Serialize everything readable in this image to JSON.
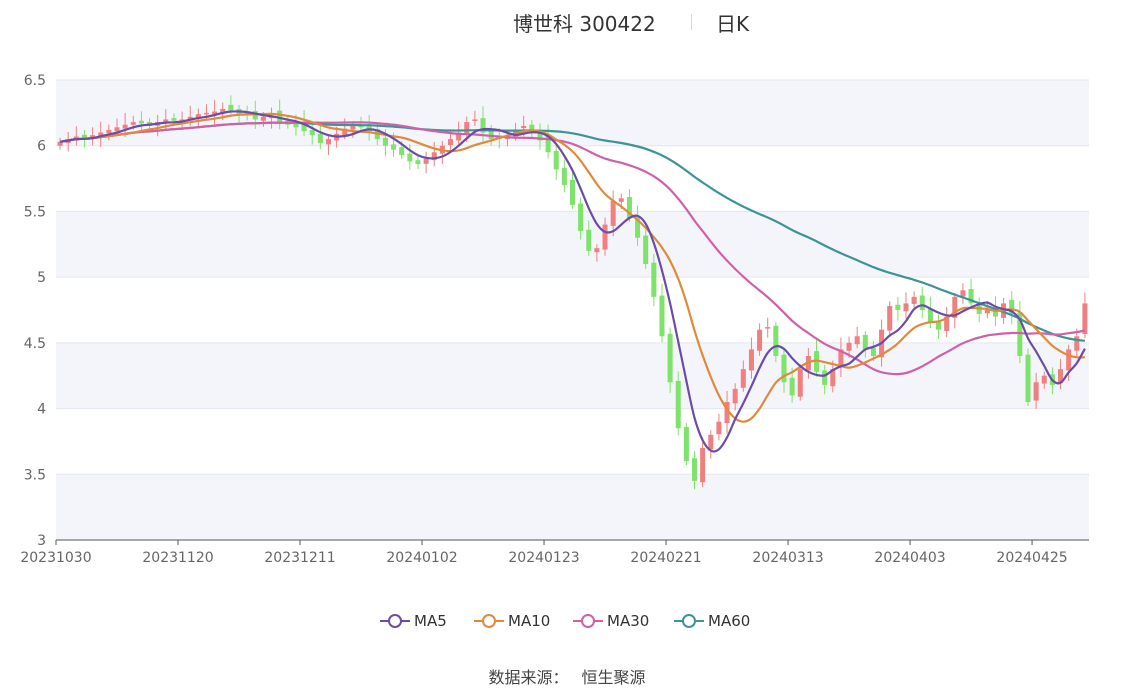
{
  "title": {
    "main": "博世科 300422",
    "sub": "日K"
  },
  "source": {
    "label": "数据来源：",
    "value": "恒生聚源"
  },
  "colors": {
    "up": "#f08080",
    "down": "#7ee36a",
    "ma5": "#6b4ca8",
    "ma10": "#e08a3c",
    "ma30": "#d160a8",
    "ma60": "#3c9498",
    "axis": "#555555",
    "grid": "#e3e6ee",
    "band": "#f4f5fa"
  },
  "chart_data": {
    "type": "candlestick",
    "ylim": [
      3,
      6.5
    ],
    "yticks": [
      "3",
      "3.5",
      "4",
      "4.5",
      "5",
      "5.5",
      "6",
      "6.5"
    ],
    "xticks": [
      "20231030",
      "20231120",
      "20231211",
      "20240102",
      "20240123",
      "20240221",
      "20240313",
      "20240403",
      "20240425"
    ],
    "xtick_index": [
      0,
      15,
      30,
      45,
      60,
      75,
      90,
      105,
      120
    ],
    "legend": [
      "MA5",
      "MA10",
      "MA30",
      "MA60"
    ],
    "close": [
      6.03,
      6.05,
      6.07,
      6.06,
      6.08,
      6.1,
      6.12,
      6.14,
      6.16,
      6.18,
      6.17,
      6.15,
      6.18,
      6.2,
      6.19,
      6.2,
      6.22,
      6.24,
      6.25,
      6.26,
      6.28,
      6.27,
      6.24,
      6.23,
      6.2,
      6.22,
      6.23,
      6.18,
      6.16,
      6.14,
      6.11,
      6.08,
      6.02,
      6.05,
      6.09,
      6.13,
      6.15,
      6.14,
      6.11,
      6.05,
      6.0,
      5.97,
      5.93,
      5.88,
      5.86,
      5.9,
      5.95,
      6.0,
      6.05,
      6.1,
      6.18,
      6.2,
      6.1,
      6.05,
      6.06,
      6.08,
      6.12,
      6.15,
      6.1,
      6.04,
      5.95,
      5.82,
      5.7,
      5.55,
      5.35,
      5.2,
      5.22,
      5.4,
      5.58,
      5.6,
      5.45,
      5.3,
      5.1,
      4.85,
      4.55,
      4.2,
      3.85,
      3.6,
      3.45,
      3.7,
      3.8,
      3.9,
      4.05,
      4.15,
      4.3,
      4.45,
      4.6,
      4.62,
      4.4,
      4.2,
      4.1,
      4.3,
      4.4,
      4.28,
      4.18,
      4.3,
      4.45,
      4.5,
      4.55,
      4.45,
      4.4,
      4.6,
      4.78,
      4.75,
      4.8,
      4.85,
      4.75,
      4.65,
      4.6,
      4.7,
      4.85,
      4.9,
      4.8,
      4.72,
      4.76,
      4.7,
      4.8,
      4.72,
      4.4,
      4.05,
      4.2,
      4.25,
      4.18,
      4.3,
      4.45,
      4.55,
      4.8
    ]
  }
}
